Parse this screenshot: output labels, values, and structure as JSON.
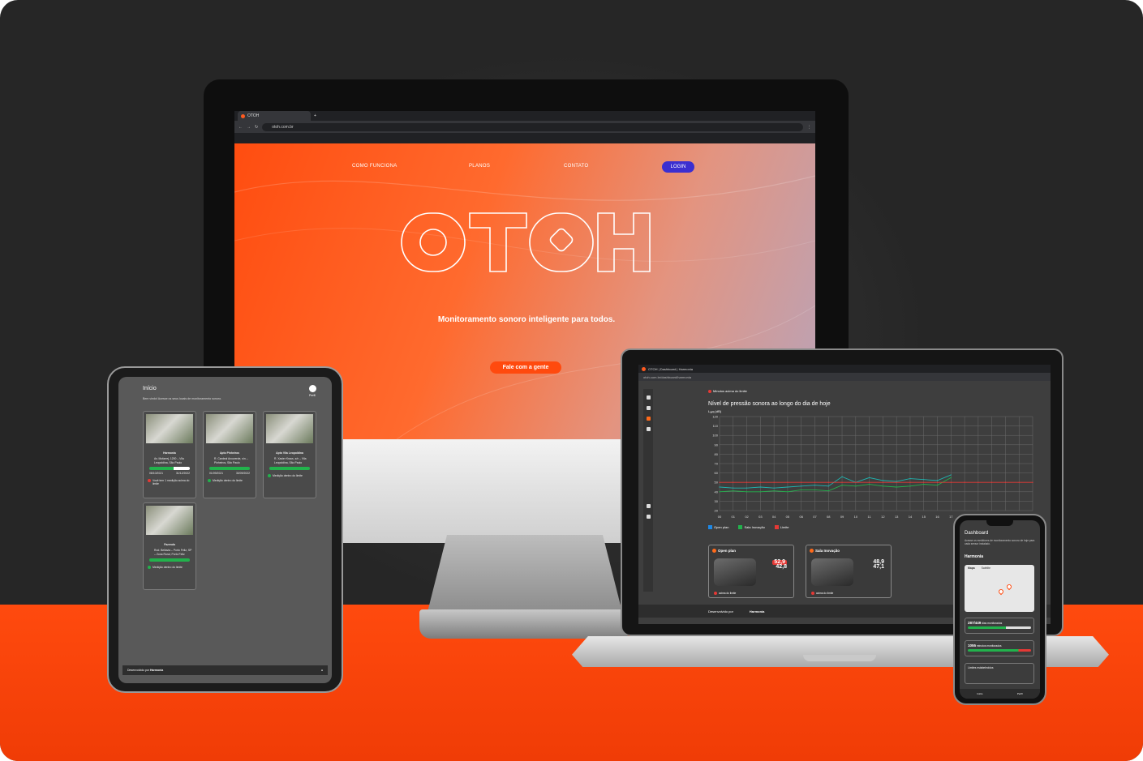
{
  "desktop": {
    "tab_title": "OTOH",
    "url": "otoh.com.br",
    "nav": [
      "COMO FUNCIONA",
      "PLANOS",
      "CONTATO"
    ],
    "login": "LOGIN",
    "logo": "OTOH",
    "tagline": "Monitoramento sonoro inteligente para todos.",
    "cta": "Fale com a gente"
  },
  "tablet": {
    "title": "Início",
    "subtitle": "Bem vindo! Acesse os seus locais de monitoramento sonoro.",
    "profile": "Perfil",
    "cards": [
      {
        "name": "Harmonia",
        "address": "Av. Mofarrej, 1200 – Vila Leopoldina, São Paulo",
        "start": "08/10/2021",
        "end": "31/12/2022",
        "status": "Você tem 1 medição acima do limite"
      },
      {
        "name": "Apto Pinheiros",
        "address": "R. Cardeal Arcoverde, s/n – Pinheiros, São Paulo",
        "start": "01/09/2021",
        "end": "30/09/2022",
        "status": "Medição dentro do limite"
      },
      {
        "name": "Apto Vila Leopoldina",
        "address": "R. Xavier Kraus, s/n – Vila Leopoldina, São Paulo",
        "start": "",
        "end": "",
        "status": "Medição dentro do limite"
      },
      {
        "name": "Fazenda",
        "address": "Rod. Bellavia – Porto Feliz, SP – Zona Rural, Porto Feliz",
        "start": "",
        "end": "",
        "status": "Medição dentro do limite"
      }
    ],
    "footer_left": "Desenvolvido por",
    "footer_brand": "Harmonia"
  },
  "laptop": {
    "tab_title": "OTOH | Dashboard | Harmonia",
    "url": "otoh.com.br/dashboard/harmonia",
    "alert": "Minutos acima do limite",
    "chart_title": "Nível de pressão sonora ao longo do dia de hoje",
    "unit_label": "Lₐₑq (dB)",
    "legend": [
      "Open plan",
      "Sala Inovação",
      "Limite"
    ],
    "devices": [
      {
        "name": "Open plan",
        "max": "52,9",
        "avg": "42,8",
        "foot": "acima do limite"
      },
      {
        "name": "Sala Inovação",
        "max": "48,9",
        "avg": "47,1",
        "foot": "acima do limite"
      }
    ],
    "footer_left": "Desenvolvido por",
    "footer_brand": "Harmonia"
  },
  "phone": {
    "title": "Dashboard",
    "subtitle": "Acesse os medidores de monitoramento sonoro de hoje para cada sensor instalado.",
    "brand": "Harmonia",
    "map_tabs": [
      "Mapa",
      "Satélite"
    ],
    "days": "287/449",
    "days_label": "dias monitorados",
    "minutes": "1055",
    "minutes_label": "minutos monitorados",
    "limits_label": "Limites estabelecidos",
    "nav": [
      "Início",
      "Perfil"
    ]
  },
  "chart_data": {
    "type": "line",
    "title": "Nível de pressão sonora ao longo do dia de hoje",
    "ylabel": "Lₐₑq (dB)",
    "x": [
      "00",
      "01",
      "02",
      "03",
      "04",
      "05",
      "06",
      "07",
      "08",
      "09",
      "10",
      "11",
      "12",
      "13",
      "14",
      "15",
      "16",
      "17",
      "18",
      "19",
      "20",
      "21",
      "22",
      "23"
    ],
    "ylim": [
      20,
      120
    ],
    "yticks": [
      20,
      30,
      40,
      50,
      60,
      70,
      80,
      90,
      100,
      110,
      120
    ],
    "series": [
      {
        "name": "Open plan",
        "color": "#22b24c",
        "values": [
          40,
          41,
          40,
          40,
          41,
          40,
          42,
          42,
          41,
          47,
          46,
          48,
          46,
          45,
          46,
          48,
          47,
          55
        ]
      },
      {
        "name": "Sala Inovação",
        "color": "#1fb4b0",
        "values": [
          45,
          44,
          44,
          45,
          44,
          45,
          46,
          47,
          46,
          56,
          50,
          55,
          52,
          51,
          54,
          53,
          52,
          58
        ]
      },
      {
        "name": "Limite",
        "color": "#e53935",
        "values": [
          50,
          50,
          50,
          50,
          50,
          50,
          50,
          50,
          50,
          50,
          50,
          50,
          50,
          50,
          50,
          50,
          50,
          50,
          50,
          50,
          50,
          50,
          50,
          50
        ]
      }
    ],
    "grid": true
  }
}
